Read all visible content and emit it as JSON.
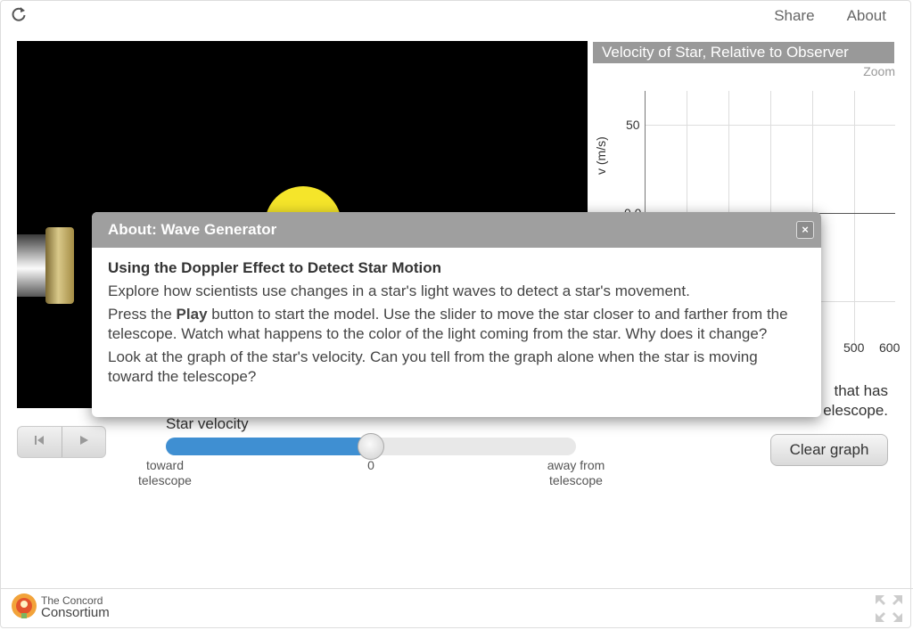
{
  "top_nav": {
    "share": "Share",
    "about": "About"
  },
  "graph": {
    "title": "Velocity of Star, Relative to Observer",
    "zoom": "Zoom",
    "ylabel": "v (m/s)",
    "y_ticks": [
      "50",
      "0.0"
    ],
    "x_ticks": [
      "500",
      "600"
    ]
  },
  "readout": {
    "line1": "that has",
    "line2": "elescope."
  },
  "slider": {
    "label": "Star velocity",
    "left_label_1": "toward",
    "left_label_2": "telescope",
    "center_label": "0",
    "right_label_1": "away from",
    "right_label_2": "telescope",
    "value_fraction": 0.5
  },
  "clear_button": "Clear graph",
  "footer": {
    "logo_line1": "The Concord",
    "logo_line2": "Consortium"
  },
  "modal": {
    "title": "About: Wave Generator",
    "close": "×",
    "heading": "Using the Doppler Effect to Detect Star Motion",
    "p1": "Explore how scientists use changes in a star's light waves to detect a star's movement.",
    "p2_before": "Press the ",
    "p2_bold": "Play",
    "p2_after": " button to start the model. Use the slider to move the star closer to and farther from the telescope. Watch what happens to the color of the light coming from the star. Why does it change?",
    "p3": "Look at the graph of the star's velocity. Can you tell from the graph alone when the star is moving toward the telescope?"
  },
  "colors": {
    "slider_fill": "#3f8fd2",
    "star": "#f5e52a",
    "header_gray": "#9f9f9f"
  }
}
